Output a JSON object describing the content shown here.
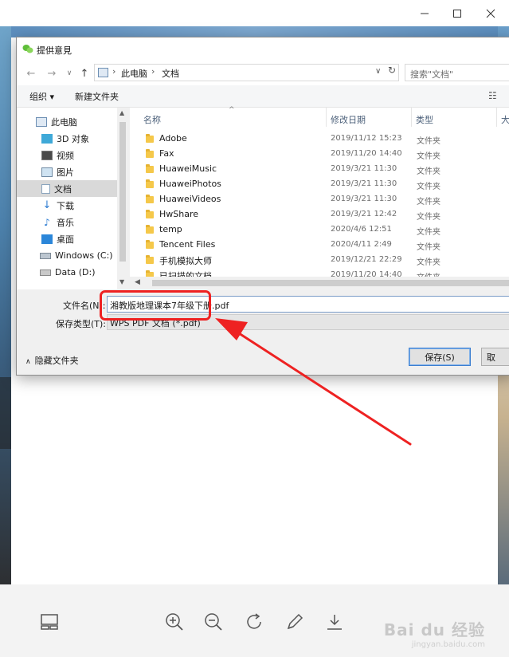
{
  "viewer": {
    "window_controls": {
      "minimize": "—",
      "maximize": "☐",
      "close": "✕"
    },
    "toolbar_icons": [
      "layout-icon",
      "zoom-in-icon",
      "zoom-out-icon",
      "rotate-icon",
      "edit-pen-icon",
      "download-icon"
    ],
    "watermark_main": "Bai du 经验",
    "watermark_sub": "jingyan.baidu.com"
  },
  "dialog": {
    "title": "提供意見",
    "address": {
      "breadcrumbs": [
        "此电脑",
        "文档"
      ],
      "search_placeholder": "搜索\"文档\""
    },
    "command_bar": {
      "organize_label": "组织 ▾",
      "new_folder_label": "新建文件夹"
    },
    "nav_items": [
      {
        "label": "此电脑",
        "icon": "computer-icon"
      },
      {
        "label": "3D 对象",
        "icon": "3d-objects-icon"
      },
      {
        "label": "视频",
        "icon": "video-icon"
      },
      {
        "label": "图片",
        "icon": "pictures-icon"
      },
      {
        "label": "文档",
        "icon": "documents-icon",
        "selected": true
      },
      {
        "label": "下载",
        "icon": "downloads-icon"
      },
      {
        "label": "音乐",
        "icon": "music-icon"
      },
      {
        "label": "桌面",
        "icon": "desktop-icon"
      },
      {
        "label": "Windows (C:)",
        "icon": "drive-icon"
      },
      {
        "label": "Data (D:)",
        "icon": "drive-icon"
      }
    ],
    "columns": {
      "name": "名称",
      "modified": "修改日期",
      "type": "类型",
      "size": "大"
    },
    "files": [
      {
        "name": "Adobe",
        "modified": "2019/11/12 15:23",
        "type": "文件夹"
      },
      {
        "name": "Fax",
        "modified": "2019/11/20 14:40",
        "type": "文件夹"
      },
      {
        "name": "HuaweiMusic",
        "modified": "2019/3/21 11:30",
        "type": "文件夹"
      },
      {
        "name": "HuaweiPhotos",
        "modified": "2019/3/21 11:30",
        "type": "文件夹"
      },
      {
        "name": "HuaweiVideos",
        "modified": "2019/3/21 11:30",
        "type": "文件夹"
      },
      {
        "name": "HwShare",
        "modified": "2019/3/21 12:42",
        "type": "文件夹"
      },
      {
        "name": "temp",
        "modified": "2020/4/6 12:51",
        "type": "文件夹"
      },
      {
        "name": "Tencent Files",
        "modified": "2020/4/11 2:49",
        "type": "文件夹"
      },
      {
        "name": "手机模拟大师",
        "modified": "2019/12/21 22:29",
        "type": "文件夹"
      },
      {
        "name": "已扫描的文档",
        "modified": "2019/11/20 14:40",
        "type": "文件夹"
      }
    ],
    "form": {
      "filename_label": "文件名(N):",
      "filename_value": "湘教版地理课本7年级下册.pdf",
      "filetype_label": "保存类型(T):",
      "filetype_value": "WPS PDF 文档 (*.pdf)",
      "hide_folders_label": "隐藏文件夹",
      "save_label": "保存(S)",
      "cancel_label": "取"
    }
  },
  "annotation": {
    "highlight_color": "#ee2222",
    "arrow_color": "#ee2222"
  }
}
